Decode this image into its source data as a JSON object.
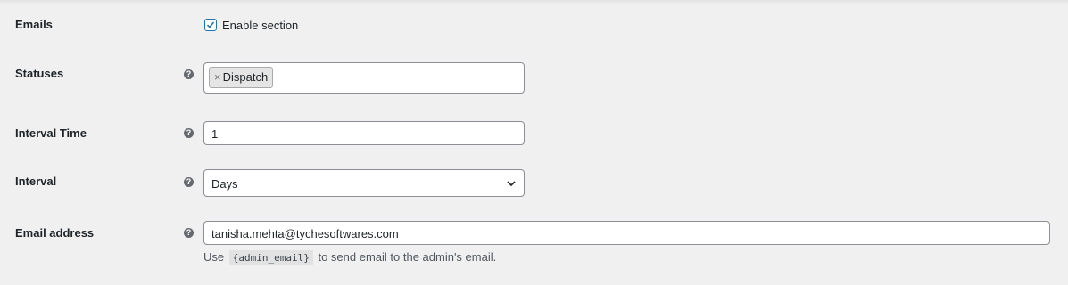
{
  "rows": {
    "emails": {
      "label": "Emails",
      "checkbox_label": "Enable section",
      "checked": true
    },
    "statuses": {
      "label": "Statuses",
      "help_icon": "question-circle-icon",
      "selected": [
        {
          "remove": "×",
          "label": "Dispatch"
        }
      ]
    },
    "interval_time": {
      "label": "Interval Time",
      "help_icon": "question-circle-icon",
      "value": "1"
    },
    "interval": {
      "label": "Interval",
      "help_icon": "question-circle-icon",
      "value": "Days",
      "dropdown_icon": "chevron-down-icon"
    },
    "email_address": {
      "label": "Email address",
      "help_icon": "question-circle-icon",
      "value": "tanisha.mehta@tychesoftwares.com",
      "description_before": "Use",
      "description_code": "{admin_email}",
      "description_after": "to send email to the admin's email."
    }
  },
  "colors": {
    "background": "#f0f0f1",
    "accent": "#2271b1",
    "border": "#8c8f94",
    "help_icon": "#646970"
  }
}
